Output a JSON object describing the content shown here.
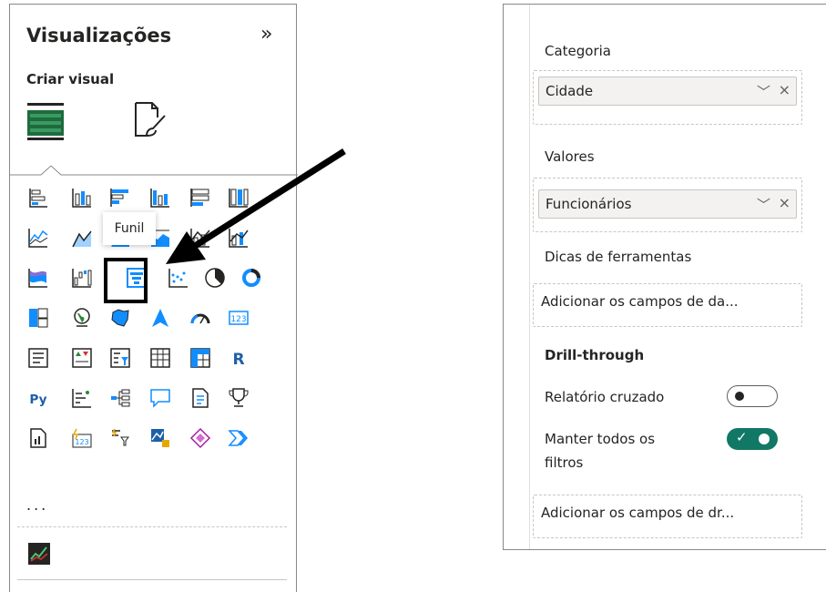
{
  "visualizations": {
    "title": "Visualizações",
    "collapse_icon": "double-chevron-right-icon",
    "build_label": "Criar visual",
    "tabs": [
      "build-visual-icon",
      "format-visual-icon"
    ],
    "tooltip": "Funil",
    "more": "...",
    "selected_visual": "funnel-chart-icon",
    "highlight_color": "#000000",
    "accent": "#118DFF"
  },
  "fields": {
    "category_label": "Categoria",
    "category_field": "Cidade",
    "values_label": "Valores",
    "values_field": "Funcionários",
    "tooltips_label": "Dicas de ferramentas",
    "tooltips_placeholder": "Adicionar os campos de da...",
    "drillthrough_label": "Drill-through",
    "cross_report_label": "Relatório cruzado",
    "cross_report_state": "off",
    "keep_filters_label_1": "Manter todos os",
    "keep_filters_label_2": "filtros",
    "keep_filters_state": "on",
    "drillthrough_placeholder": "Adicionar os campos de dr...",
    "toggle_on_color": "#117865"
  }
}
